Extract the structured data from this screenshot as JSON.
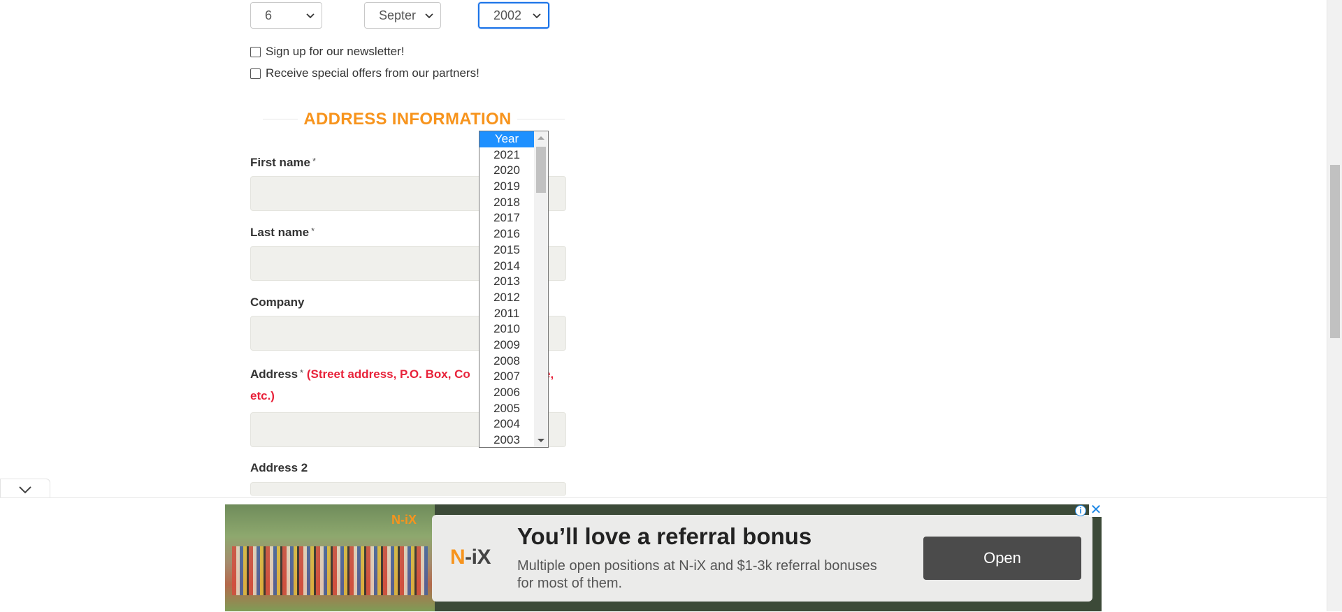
{
  "dob": {
    "day": "6",
    "month": "Septer",
    "year": "2002"
  },
  "checkboxes": {
    "newsletter": "Sign up for our newsletter!",
    "offers": "Receive special offers from our partners!"
  },
  "address_section": {
    "title": "ADDRESS INFORMATION",
    "required_mark": "*",
    "first_name_label": "First name",
    "last_name_label": "Last name",
    "company_label": "Company",
    "address_label": "Address",
    "address_hint_part1": "(Street address, P.O. Box, Co",
    "address_hint_part2": "e,",
    "address_hint_line2": "etc.)",
    "address2_label": "Address 2"
  },
  "year_dropdown": {
    "options": [
      "Year",
      "2021",
      "2020",
      "2019",
      "2018",
      "2017",
      "2016",
      "2015",
      "2014",
      "2013",
      "2012",
      "2011",
      "2010",
      "2009",
      "2008",
      "2007",
      "2006",
      "2005",
      "2004",
      "2003"
    ],
    "highlighted": "Year"
  },
  "ad": {
    "photo_logo": "N-iX",
    "brand_n": "N",
    "brand_rest": "-iX",
    "headline": "You’ll love a referral bonus",
    "body": "Multiple open positions at N-iX and $1-3k referral bonuses for most of them.",
    "cta": "Open",
    "info_glyph": "i",
    "close_glyph": "✕"
  },
  "colors": {
    "section_title": "#f7941d",
    "hint_red": "#e8223a",
    "dropdown_highlight": "#1e90ff",
    "focus_border": "#1a73e8"
  }
}
